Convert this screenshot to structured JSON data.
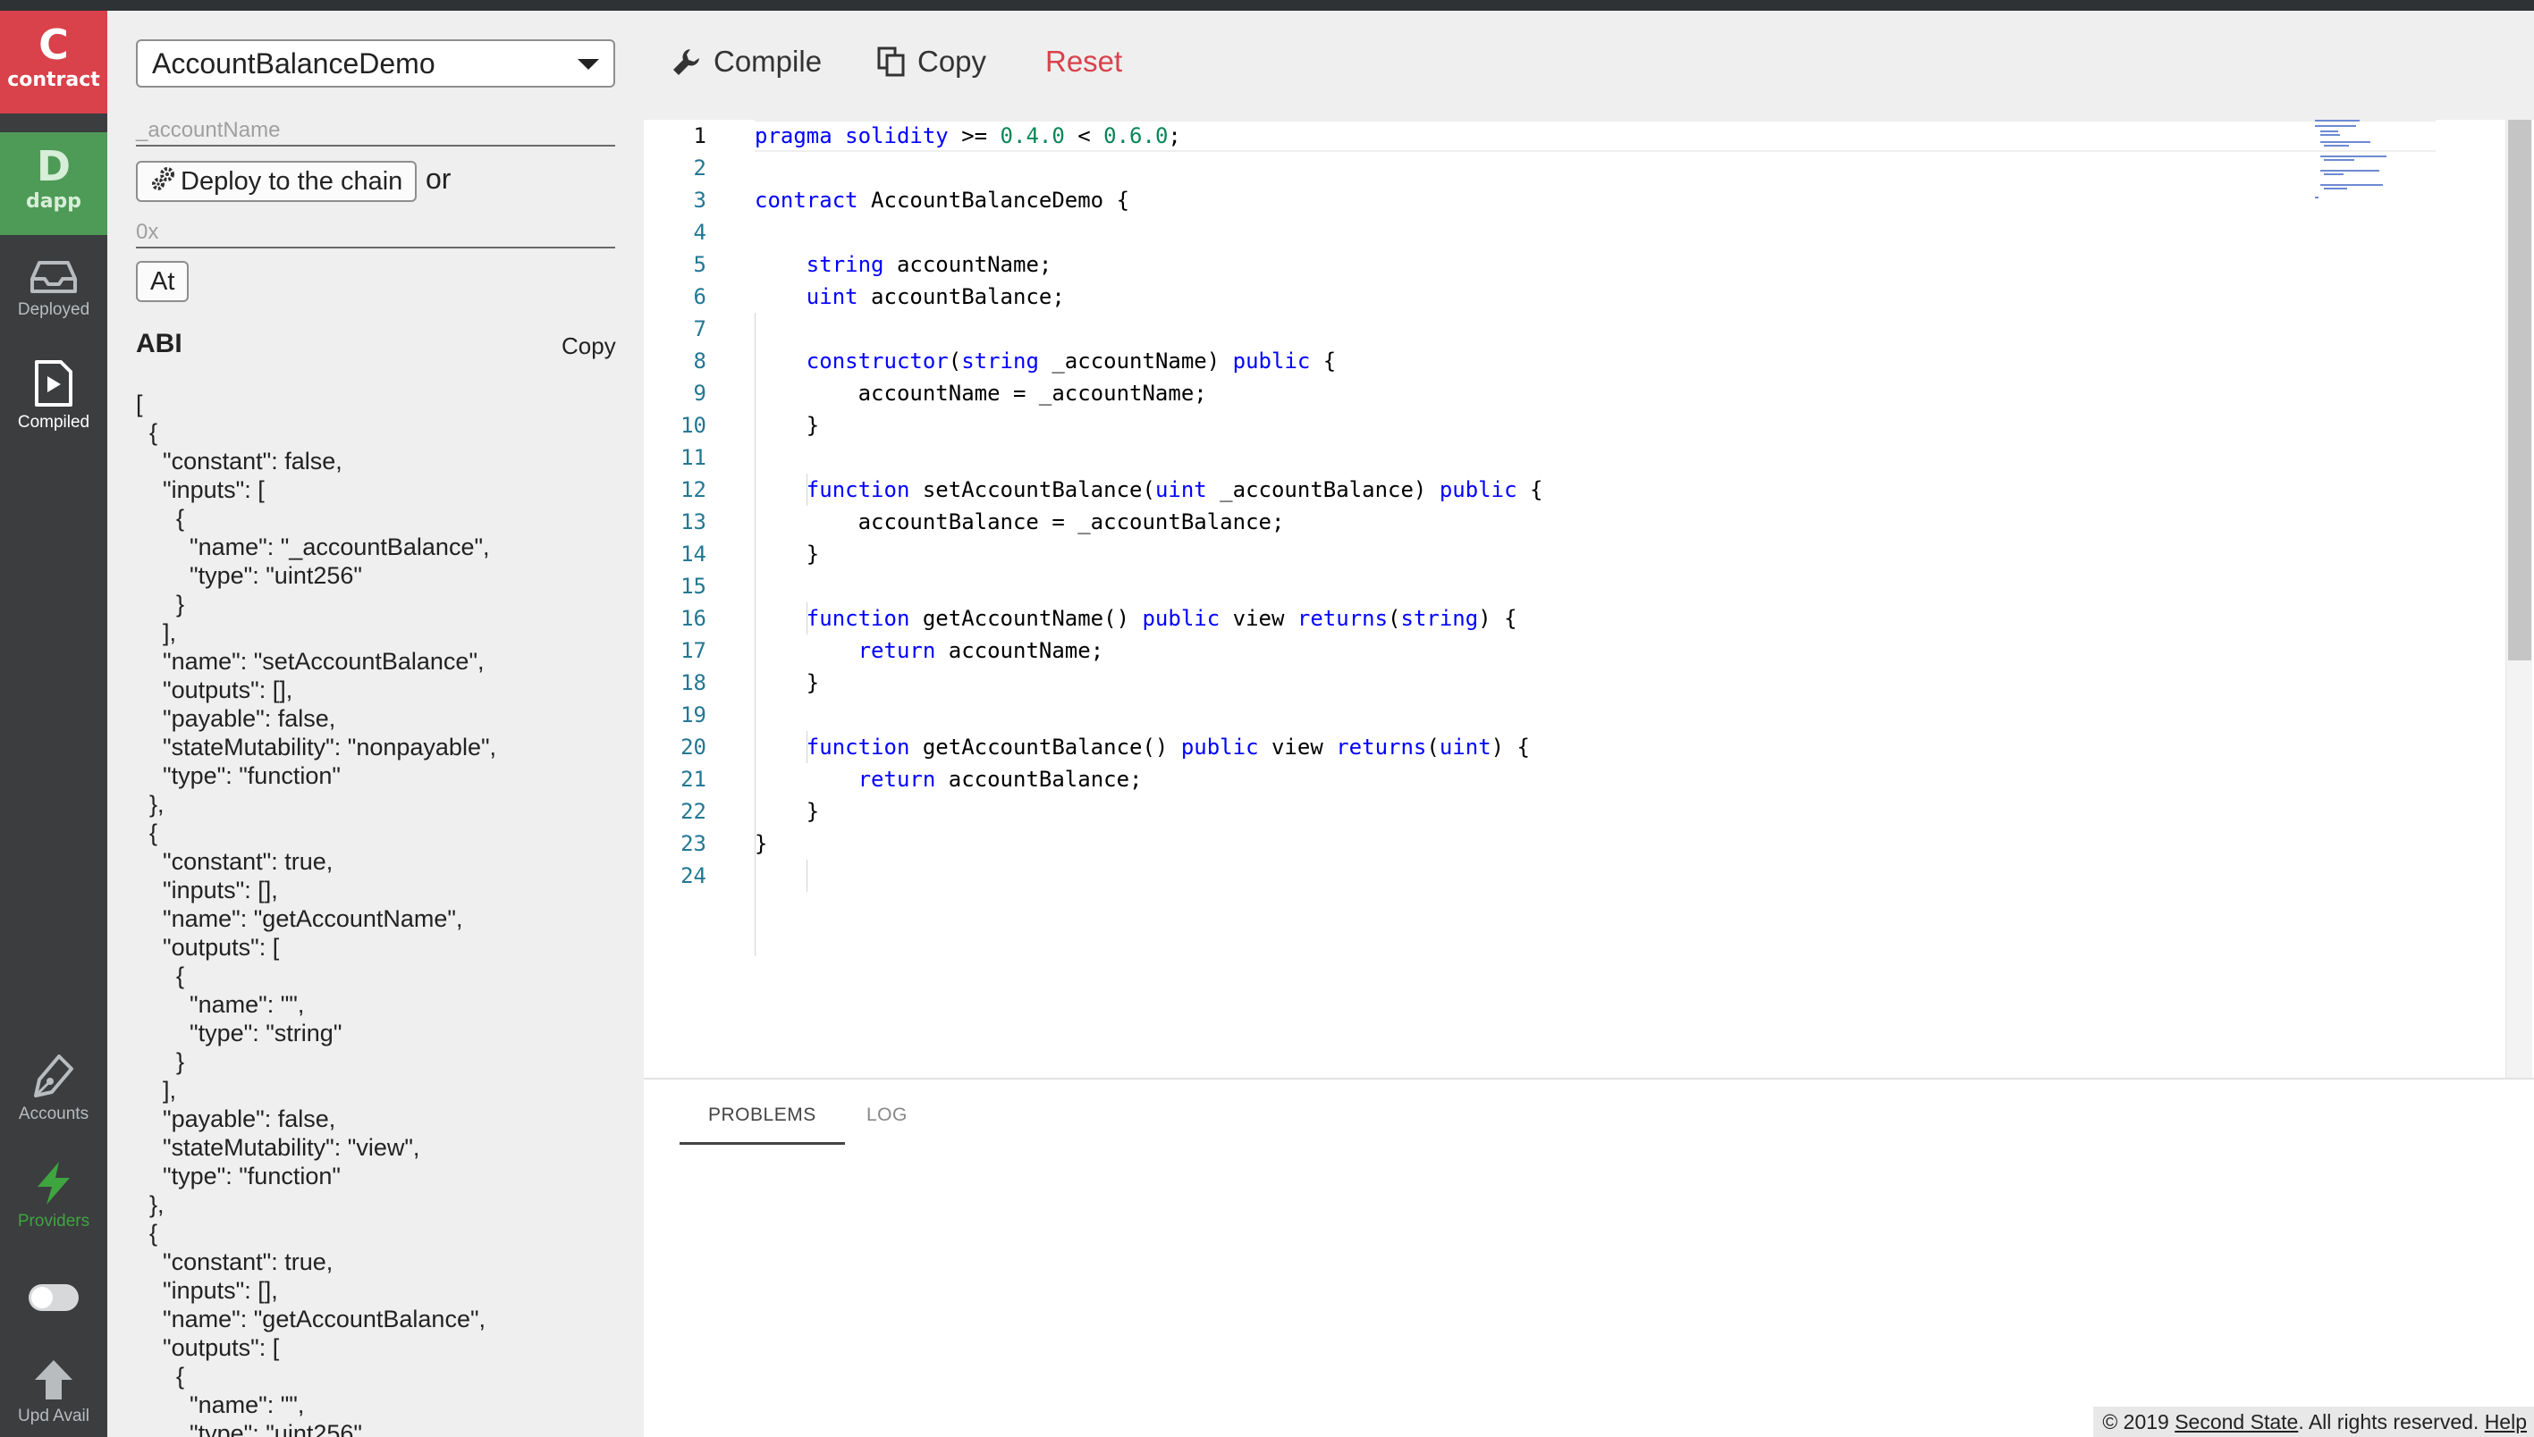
{
  "rail": {
    "contract_letter": "C",
    "contract_label": "contract",
    "dapp_letter": "D",
    "dapp_label": "dapp",
    "deployed_label": "Deployed",
    "compiled_label": "Compiled",
    "accounts_label": "Accounts",
    "providers_label": "Providers",
    "update_label": "Upd Avail",
    "colors": {
      "contract": "#d9424b",
      "dapp": "#4e9a57",
      "rail": "#3b3d3f",
      "providers": "#3ea53f"
    }
  },
  "panel": {
    "contract_select": "AccountBalanceDemo",
    "constructor_arg_placeholder": "_accountName",
    "deploy_button": "Deploy to the chain",
    "or_text": "or",
    "address_placeholder": "0x",
    "at_button": "At",
    "abi_title": "ABI",
    "abi_copy": "Copy",
    "abi_json": "[\n  {\n    \"constant\": false,\n    \"inputs\": [\n      {\n        \"name\": \"_accountBalance\",\n        \"type\": \"uint256\"\n      }\n    ],\n    \"name\": \"setAccountBalance\",\n    \"outputs\": [],\n    \"payable\": false,\n    \"stateMutability\": \"nonpayable\",\n    \"type\": \"function\"\n  },\n  {\n    \"constant\": true,\n    \"inputs\": [],\n    \"name\": \"getAccountName\",\n    \"outputs\": [\n      {\n        \"name\": \"\",\n        \"type\": \"string\"\n      }\n    ],\n    \"payable\": false,\n    \"stateMutability\": \"view\",\n    \"type\": \"function\"\n  },\n  {\n    \"constant\": true,\n    \"inputs\": [],\n    \"name\": \"getAccountBalance\",\n    \"outputs\": [\n      {\n        \"name\": \"\",\n        \"type\": \"uint256\""
  },
  "toolbar": {
    "compile": "Compile",
    "copy": "Copy",
    "reset": "Reset",
    "reset_color": "#d9424b"
  },
  "editor": {
    "lines": [
      [
        [
          "kw",
          "pragma"
        ],
        [
          "t",
          " "
        ],
        [
          "kw",
          "solidity"
        ],
        [
          "t",
          " >= "
        ],
        [
          "num",
          "0.4.0"
        ],
        [
          "t",
          " < "
        ],
        [
          "num",
          "0.6.0"
        ],
        [
          "t",
          ";"
        ]
      ],
      [],
      [
        [
          "kw",
          "contract"
        ],
        [
          "t",
          " AccountBalanceDemo {"
        ]
      ],
      [],
      [
        [
          "t",
          "    "
        ],
        [
          "kw",
          "string"
        ],
        [
          "t",
          " accountName;"
        ]
      ],
      [
        [
          "t",
          "    "
        ],
        [
          "kw",
          "uint"
        ],
        [
          "t",
          " accountBalance;"
        ]
      ],
      [],
      [
        [
          "t",
          "    "
        ],
        [
          "kw",
          "constructor"
        ],
        [
          "t",
          "("
        ],
        [
          "kw",
          "string"
        ],
        [
          "t",
          " _accountName) "
        ],
        [
          "kw",
          "public"
        ],
        [
          "t",
          " {"
        ]
      ],
      [
        [
          "t",
          "        accountName = _accountName;"
        ]
      ],
      [
        [
          "t",
          "    }"
        ]
      ],
      [],
      [
        [
          "t",
          "    "
        ],
        [
          "kw",
          "function"
        ],
        [
          "t",
          " setAccountBalance("
        ],
        [
          "kw",
          "uint"
        ],
        [
          "t",
          " _accountBalance) "
        ],
        [
          "kw",
          "public"
        ],
        [
          "t",
          " {"
        ]
      ],
      [
        [
          "t",
          "        accountBalance = _accountBalance;"
        ]
      ],
      [
        [
          "t",
          "    }"
        ]
      ],
      [],
      [
        [
          "t",
          "    "
        ],
        [
          "kw",
          "function"
        ],
        [
          "t",
          " getAccountName() "
        ],
        [
          "kw",
          "public"
        ],
        [
          "t",
          " view "
        ],
        [
          "kw",
          "returns"
        ],
        [
          "t",
          "("
        ],
        [
          "kw",
          "string"
        ],
        [
          "t",
          ") {"
        ]
      ],
      [
        [
          "t",
          "        "
        ],
        [
          "kw",
          "return"
        ],
        [
          "t",
          " accountName;"
        ]
      ],
      [
        [
          "t",
          "    }"
        ]
      ],
      [],
      [
        [
          "t",
          "    "
        ],
        [
          "kw",
          "function"
        ],
        [
          "t",
          " getAccountBalance() "
        ],
        [
          "kw",
          "public"
        ],
        [
          "t",
          " view "
        ],
        [
          "kw",
          "returns"
        ],
        [
          "t",
          "("
        ],
        [
          "kw",
          "uint"
        ],
        [
          "t",
          ") {"
        ]
      ],
      [
        [
          "t",
          "        "
        ],
        [
          "kw",
          "return"
        ],
        [
          "t",
          " accountBalance;"
        ]
      ],
      [
        [
          "t",
          "    }"
        ]
      ],
      [
        [
          "t",
          "}"
        ]
      ],
      []
    ],
    "current_line": 1
  },
  "bottom": {
    "tab_problems": "PROBLEMS",
    "tab_log": "LOG"
  },
  "footer": {
    "copyright": "© 2019 ",
    "company": "Second State",
    "rights": ". All rights reserved. ",
    "help": "Help"
  }
}
